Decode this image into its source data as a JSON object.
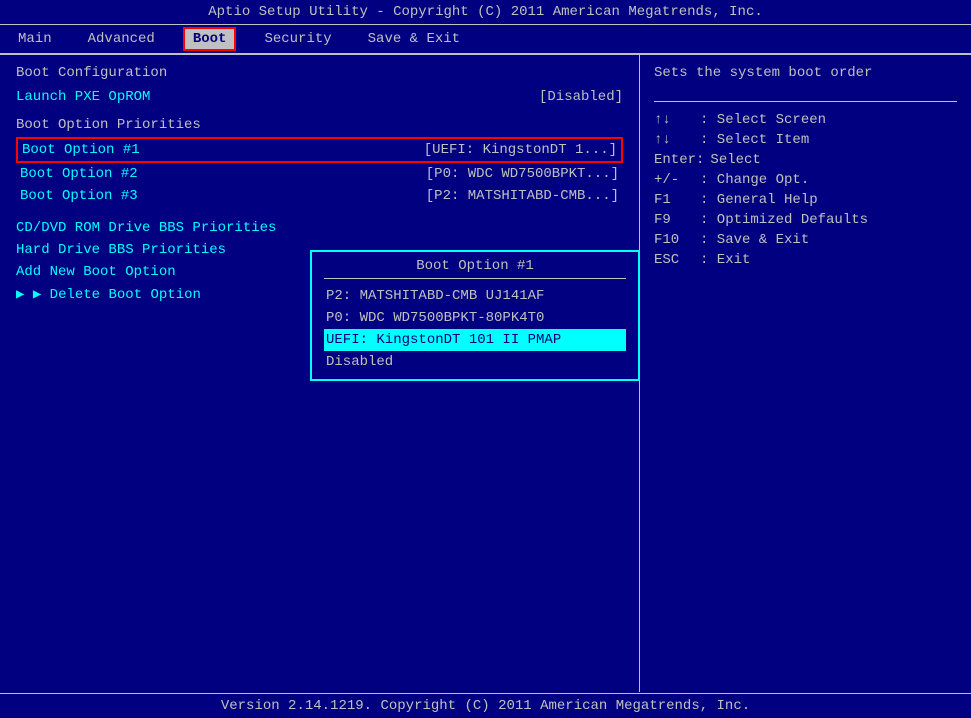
{
  "titleBar": {
    "text": "Aptio Setup Utility - Copyright (C) 2011 American Megatrends, Inc."
  },
  "nav": {
    "items": [
      {
        "id": "main",
        "label": "Main",
        "active": false
      },
      {
        "id": "advanced",
        "label": "Advanced",
        "active": false
      },
      {
        "id": "boot",
        "label": "Boot",
        "active": true
      },
      {
        "id": "security",
        "label": "Security",
        "active": false
      },
      {
        "id": "save-exit",
        "label": "Save & Exit",
        "active": false
      }
    ]
  },
  "leftPanel": {
    "bootConfigTitle": "Boot Configuration",
    "launchPXELabel": "Launch PXE OpROM",
    "launchPXEValue": "[Disabled]",
    "bootOptionPrioritiesTitle": "Boot Option Priorities",
    "bootOptions": [
      {
        "label": "Boot Option #1",
        "value": "[UEFI: KingstonDT 1...]",
        "selected": true
      },
      {
        "label": "Boot Option #2",
        "value": "[P0: WDC WD7500BPKT...]"
      },
      {
        "label": "Boot Option #3",
        "value": "[P2: MATSHITABD-CMB...]"
      }
    ],
    "menuItems": [
      {
        "label": "CD/DVD ROM Drive BBS Priorities",
        "hasArrow": false
      },
      {
        "label": "Hard Drive BBS Priorities",
        "hasArrow": false
      },
      {
        "label": "Add New Boot Option",
        "hasArrow": false
      },
      {
        "label": "Delete Boot Option",
        "hasArrow": true
      }
    ],
    "dropdown": {
      "title": "Boot Option #1",
      "options": [
        {
          "label": "P2: MATSHITABD-CMB UJ141AF",
          "highlighted": false
        },
        {
          "label": "P0: WDC WD7500BPKT-80PK4T0",
          "highlighted": false
        },
        {
          "label": "UEFI: KingstonDT 101 II PMAP",
          "highlighted": true
        },
        {
          "label": "Disabled",
          "highlighted": false
        }
      ]
    }
  },
  "rightPanel": {
    "helpText": "Sets the system boot order",
    "keyHelp": [
      {
        "key": "↑↓",
        "desc": ": Select Screen"
      },
      {
        "key": "↑↓",
        "desc": ": Select Item"
      },
      {
        "key": "Enter:",
        "desc": "Select"
      },
      {
        "key": "+/-",
        "desc": ": Change Opt."
      },
      {
        "key": "F1",
        "desc": ": General Help"
      },
      {
        "key": "F9",
        "desc": ": Optimized Defaults"
      },
      {
        "key": "F10",
        "desc": ": Save & Exit"
      },
      {
        "key": "ESC",
        "desc": ": Exit"
      }
    ]
  },
  "footer": {
    "text": "Version 2.14.1219. Copyright (C) 2011 American Megatrends, Inc."
  }
}
